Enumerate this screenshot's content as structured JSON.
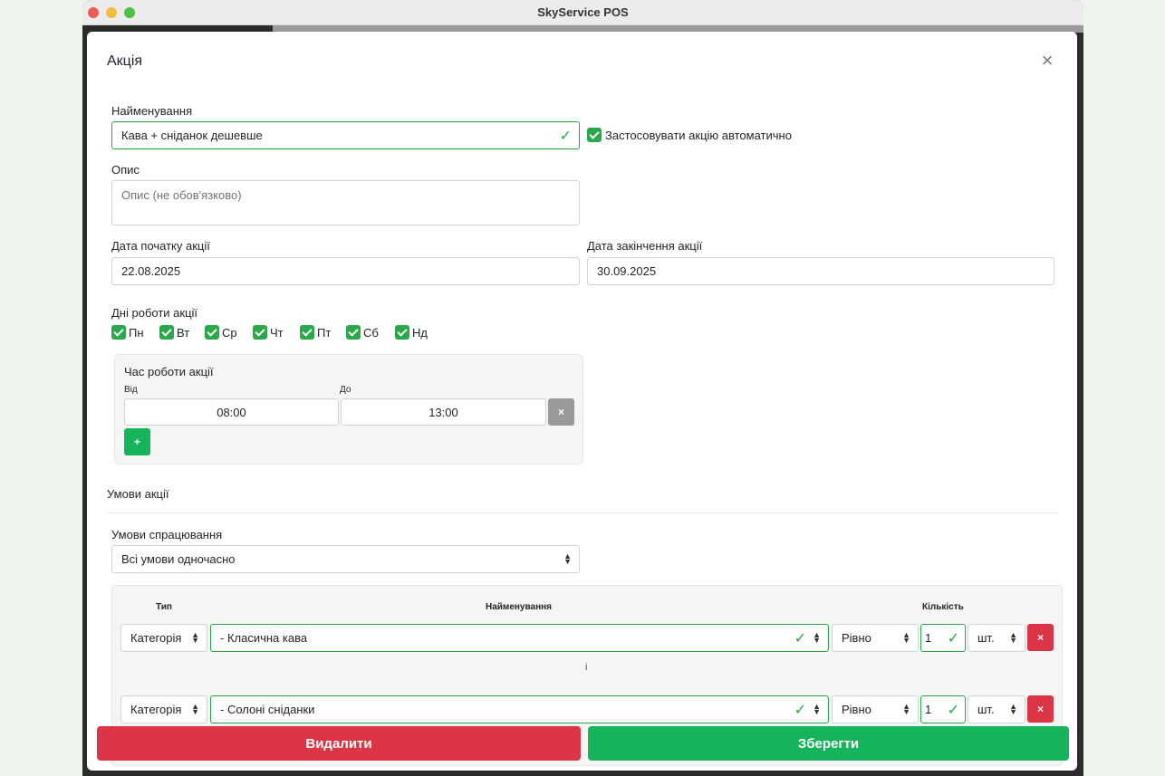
{
  "window": {
    "title": "SkyService POS"
  },
  "modal": {
    "title": "Акція",
    "name_label": "Найменування",
    "name_value": "Кава + сніданок дешевше",
    "auto_label": "Застосовувати акцію автоматично",
    "desc_label": "Опис",
    "desc_placeholder": "Опис (не обов'язково)",
    "start_label": "Дата початку акції",
    "start_value": "22.08.2025",
    "end_label": "Дата закінчення акції",
    "end_value": "30.09.2025",
    "days_label": "Дні роботи акції",
    "days": [
      "Пн",
      "Вт",
      "Ср",
      "Чт",
      "Пт",
      "Сб",
      "Нд"
    ],
    "time": {
      "title": "Час роботи акції",
      "from_label": "Від",
      "to_label": "До",
      "from_value": "08:00",
      "to_value": "13:00",
      "remove": "×",
      "add": "+"
    },
    "conditions": {
      "section_title": "Умови акції",
      "trigger_label": "Умови спрацювання",
      "trigger_value": "Всі умови одночасно",
      "col_type": "Тип",
      "col_name": "Найменування",
      "col_qty": "Кількість",
      "separator": "і",
      "rows": [
        {
          "type": "Категорія",
          "name": "- Класична кава",
          "op": "Рівно",
          "qty": "1",
          "unit": "шт.",
          "remove": "×"
        },
        {
          "type": "Категорія",
          "name": "- Солоні сніданки",
          "op": "Рівно",
          "qty": "1",
          "unit": "шт.",
          "remove": "×"
        }
      ]
    },
    "delete_label": "Видалити",
    "save_label": "Зберегти"
  },
  "colors": {
    "green": "#16b45b",
    "red": "#dc3545",
    "check": "#28a745"
  }
}
